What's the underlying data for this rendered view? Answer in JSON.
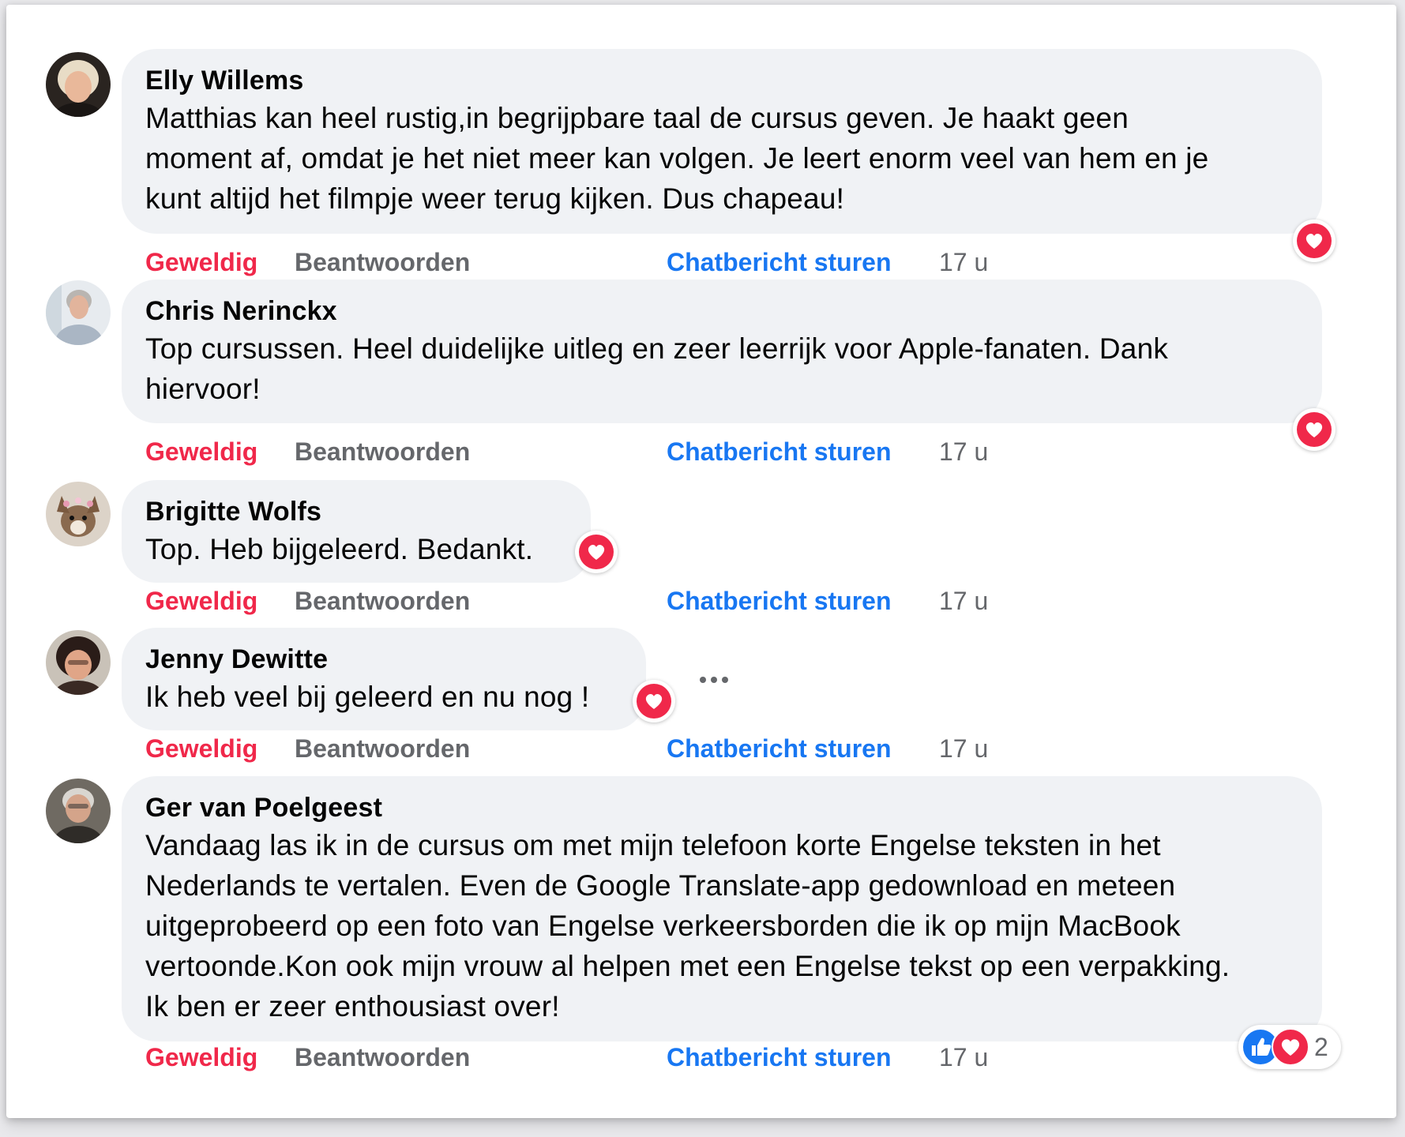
{
  "colors": {
    "like_action": "#f0284a",
    "secondary_text": "#65676b",
    "link_blue": "#1877f2",
    "bubble_bg": "#f0f2f5",
    "love_red": "#f0284a"
  },
  "comments": [
    {
      "author": "Elly Willems",
      "text_lines": [
        "Matthias kan heel rustig,in begrijpbare taal de cursus geven. Je haakt geen",
        "moment af, omdat je het niet meer kan volgen. Je leert enorm veel van hem en je",
        "kunt altijd het filmpje weer terug kijken. Dus chapeau!"
      ],
      "like_label": "Geweldig",
      "reply_label": "Beantwoorden",
      "chat_label": "Chatbericht sturen",
      "time": "17 u",
      "reaction_icon": "love-icon"
    },
    {
      "author": "Chris Nerinckx",
      "text_lines": [
        "Top cursussen. Heel duidelijke uitleg en zeer leerrijk voor Apple-fanaten. Dank",
        "hiervoor!"
      ],
      "like_label": "Geweldig",
      "reply_label": "Beantwoorden",
      "chat_label": "Chatbericht sturen",
      "time": "17 u",
      "reaction_icon": "love-icon"
    },
    {
      "author": "Brigitte Wolfs",
      "text_lines": [
        "Top. Heb bijgeleerd. Bedankt."
      ],
      "like_label": "Geweldig",
      "reply_label": "Beantwoorden",
      "chat_label": "Chatbericht sturen",
      "time": "17 u",
      "reaction_icon": "love-icon"
    },
    {
      "author": "Jenny Dewitte",
      "text_lines": [
        "Ik heb veel bij geleerd en nu nog !"
      ],
      "like_label": "Geweldig",
      "reply_label": "Beantwoorden",
      "chat_label": "Chatbericht sturen",
      "time": "17 u",
      "reaction_icon": "love-icon",
      "more_icon": "more-dots-icon"
    },
    {
      "author": "Ger van Poelgeest",
      "text_lines": [
        "Vandaag las ik in de cursus om met mijn telefoon korte Engelse teksten in het",
        "Nederlands te vertalen. Even de Google Translate-app gedownload en meteen",
        "uitgeprobeerd op een foto van Engelse verkeersborden die ik op mijn MacBook",
        "vertoonde.Kon ook mijn vrouw al helpen met een Engelse tekst op een verpakking.",
        "Ik ben er zeer enthousiast over!"
      ],
      "like_label": "Geweldig",
      "reply_label": "Beantwoorden",
      "chat_label": "Chatbericht sturen",
      "time": "17 u",
      "reaction_icons": [
        "like-icon",
        "love-icon"
      ],
      "reaction_count": "2"
    }
  ]
}
